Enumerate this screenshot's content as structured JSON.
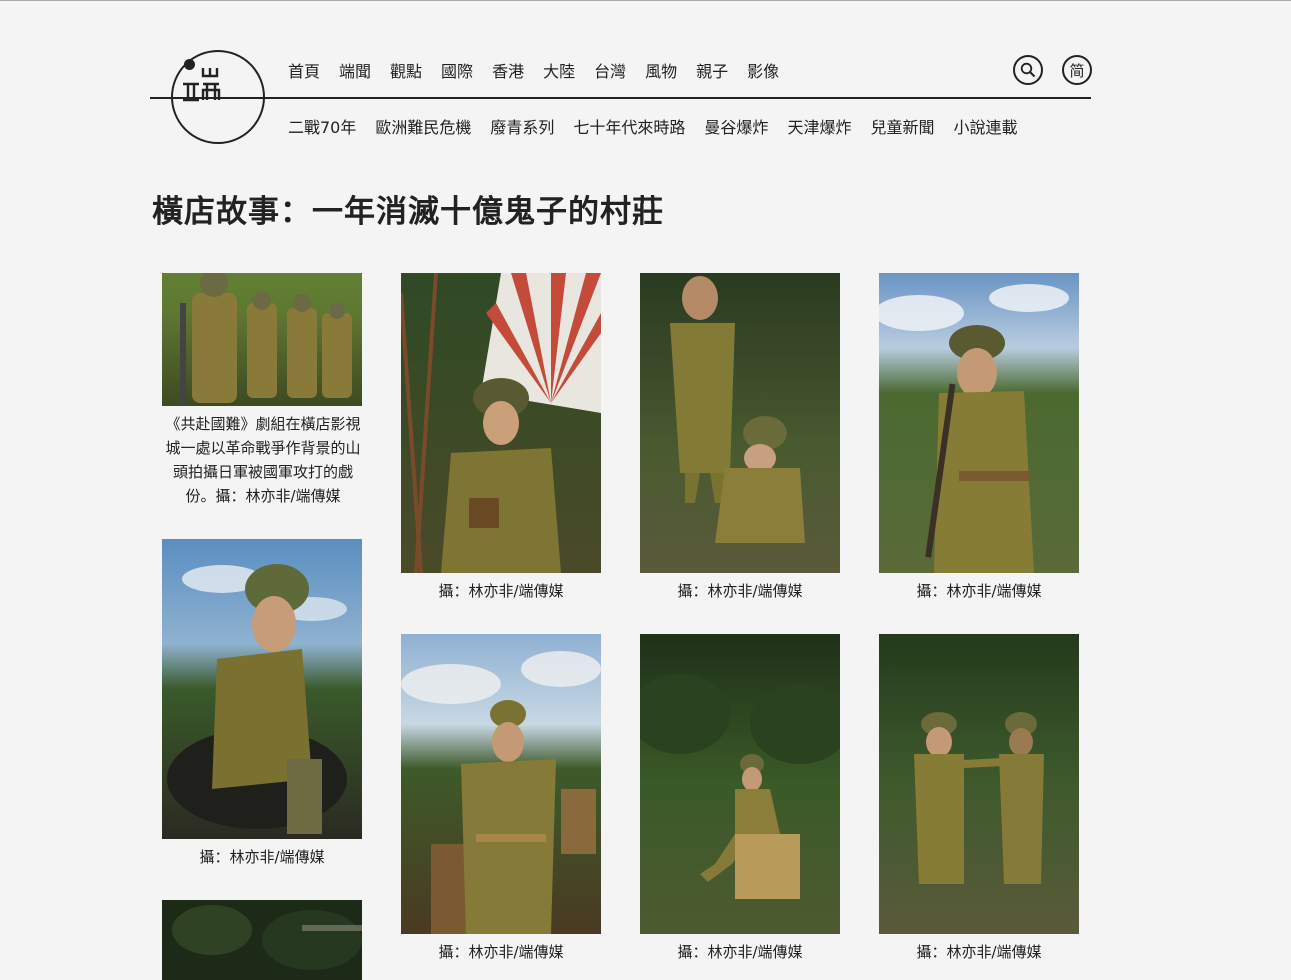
{
  "site": {
    "logo_icon": "initium-logo"
  },
  "nav": {
    "primary": [
      "首頁",
      "端聞",
      "觀點",
      "國際",
      "香港",
      "大陸",
      "台灣",
      "風物",
      "親子",
      "影像"
    ],
    "secondary": [
      "二戰70年",
      "歐洲難民危機",
      "廢青系列",
      "七十年代來時路",
      "曼谷爆炸",
      "天津爆炸",
      "兒童新聞",
      "小說連載"
    ],
    "search_icon": "search-icon",
    "lang_label": "简"
  },
  "article": {
    "title": "橫店故事：一年消滅十億鬼子的村莊"
  },
  "gallery": {
    "photos": [
      {
        "caption": "《共赴國難》劇組在橫店影視城一處以革命戰爭作背景的山頭拍攝日軍被國軍攻打的戲份。攝：林亦非/端傳媒",
        "scene": "soldiers-lineup"
      },
      {
        "caption": "攝：林亦非/端傳媒",
        "scene": "soldier-rising-sun-flag"
      },
      {
        "caption": "攝：林亦非/端傳媒",
        "scene": "two-soldiers-crouching"
      },
      {
        "caption": "攝：林亦非/端傳媒",
        "scene": "soldier-with-rifle"
      },
      {
        "caption": "攝：林亦非/端傳媒",
        "scene": "soldier-resting-chin"
      },
      {
        "caption": "攝：林亦非/端傳媒",
        "scene": "soldier-walking-barrels"
      },
      {
        "caption": "攝：林亦非/端傳媒",
        "scene": "soldier-sitting-box"
      },
      {
        "caption": "攝：林亦非/端傳媒",
        "scene": "two-soldiers-standing"
      },
      {
        "caption": "",
        "scene": "dark-foliage"
      }
    ]
  }
}
